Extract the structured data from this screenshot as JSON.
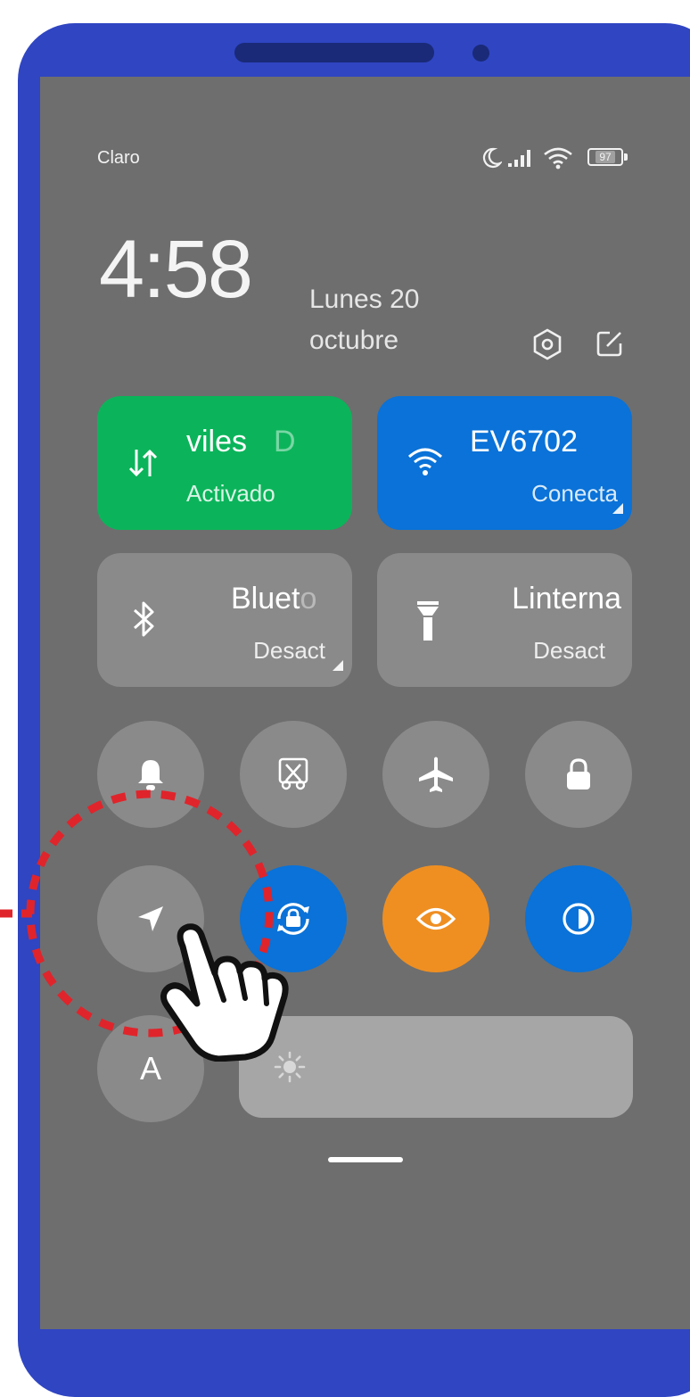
{
  "status_bar": {
    "carrier": "Claro",
    "battery": "97",
    "icons": [
      "moon-icon",
      "signal-icon",
      "wifi-icon",
      "battery-icon"
    ]
  },
  "header": {
    "time": "4:58",
    "date_line1": "Lunes 20",
    "date_line2": "octubre",
    "settings_icon": "settings-icon",
    "edit_icon": "edit-icon"
  },
  "tiles": {
    "mobile_data": {
      "title": "viles",
      "title_fade": "D",
      "status": "Activado",
      "color": "#0bb45a",
      "icon": "data-arrows-icon"
    },
    "wifi": {
      "title": "EV6702",
      "status": "Conecta",
      "color": "#0a72d8",
      "icon": "wifi-icon"
    },
    "bluetooth": {
      "title": "Bluet",
      "title_fade": "o",
      "status": "Desact",
      "icon": "bluetooth-icon"
    },
    "flashlight": {
      "title": "Linterna",
      "status": "Desact",
      "icon": "flashlight-icon"
    }
  },
  "round_toggles": [
    {
      "name": "ring-icon",
      "active": false
    },
    {
      "name": "screenshot-icon",
      "active": false
    },
    {
      "name": "airplane-icon",
      "active": false
    },
    {
      "name": "lock-icon",
      "active": false
    },
    {
      "name": "location-icon",
      "active": false
    },
    {
      "name": "rotation-lock-icon",
      "active": true,
      "color": "#0a72d8"
    },
    {
      "name": "reading-mode-icon",
      "active": true,
      "color": "#ef8f22"
    },
    {
      "name": "dark-mode-icon",
      "active": true,
      "color": "#0a72d8"
    }
  ],
  "auto_brightness": {
    "label": "A"
  },
  "brightness": {
    "icon": "sun-icon"
  },
  "annotation": {
    "highlight_color": "#e0242b",
    "pointer": "hand-pointer-icon"
  },
  "colors": {
    "frame": "#2f45c2",
    "screen": "#6e6e6e",
    "tile_gray": "#8a8a8a"
  }
}
